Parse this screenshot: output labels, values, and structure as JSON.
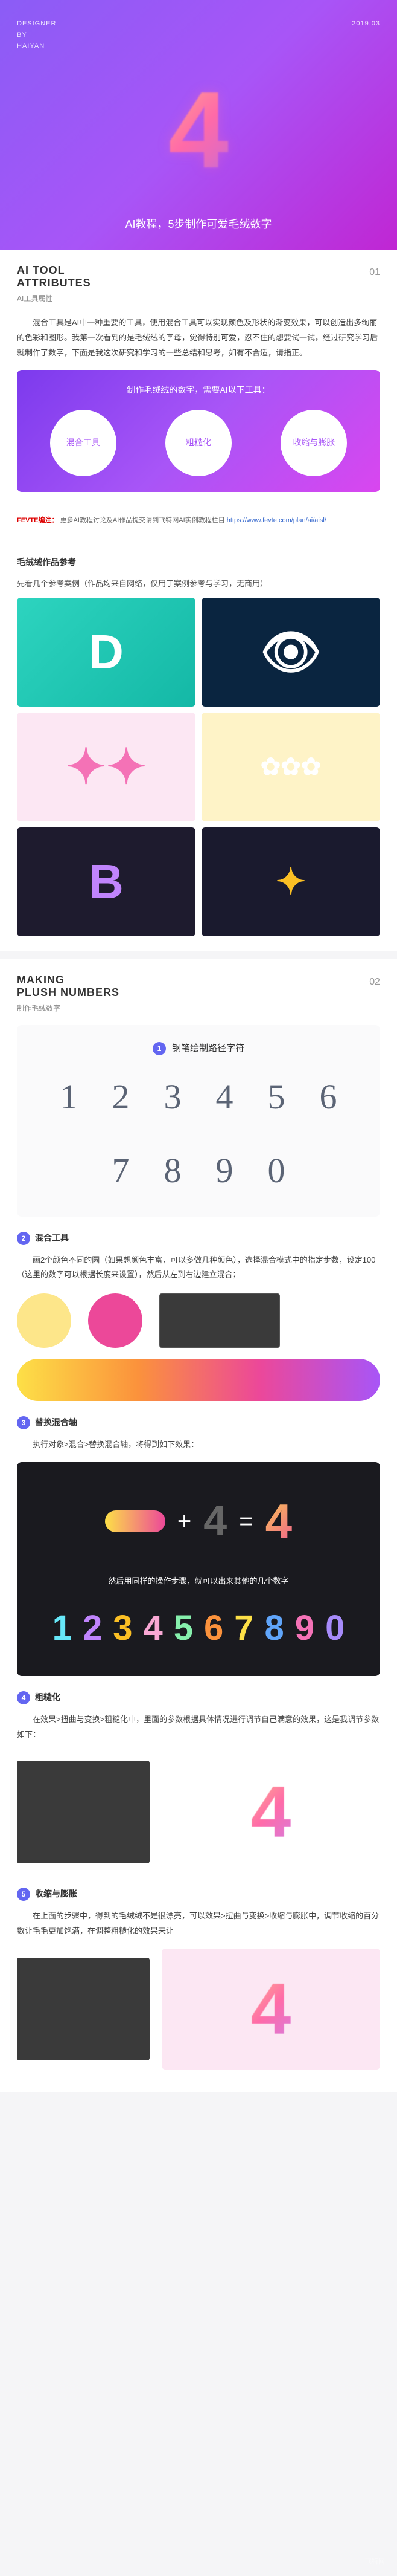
{
  "hero": {
    "designer_label": "DESIGNER\nBY\nHAIYAN",
    "date": "2019.03",
    "title": "AI教程，5步制作可爱毛绒数字"
  },
  "sec1": {
    "en1": "AI TOOL",
    "en2": "ATTRIBUTES",
    "num": "01",
    "cn": "AI工具属性",
    "para": "混合工具是AI中一种重要的工具，使用混合工具可以实现颜色及形状的渐变效果，可以创造出多绚丽的色彩和图形。我第一次看到的是毛绒绒的字母，觉得特别可爱，忍不住的想要试一试，经过研究学习后就制作了数字，下面是我这次研究和学习的一些总结和思考，如有不合适，请指正。",
    "card_title": "制作毛绒绒的数字，需要AI以下工具：",
    "c1": "混合工具",
    "c2": "粗糙化",
    "c3": "收缩与膨胀"
  },
  "notice": {
    "label": "FEVTE编注：",
    "text": "更多AI教程讨论及AI作品提交请到飞特网AI实例教程栏目",
    "url": "https://www.fevte.com/plan/ai/aisl/"
  },
  "ref": {
    "title": "毛绒绒作品参考",
    "desc": "先看几个参考案例（作品均来自网络，仅用于案例参考与学习，无商用）"
  },
  "sec2": {
    "en1": "MAKING",
    "en2": "PLUSH NUMBERS",
    "num": "02",
    "cn": "制作毛绒数字",
    "step1_title": "钢笔绘制路径字符",
    "numbers": [
      "1",
      "2",
      "3",
      "4",
      "5",
      "6",
      "7",
      "8",
      "9",
      "0"
    ],
    "step2_title": "混合工具",
    "step2_para": "画2个颜色不同的圆（如果想颜色丰富，可以多做几种颜色），选择混合模式中的指定步数，设定100（这里的数字可以根据长度来设置），然后从左到右边建立混合；",
    "step3_title": "替换混合轴",
    "step3_para": "执行对象>混合>替换混合轴，将得到如下效果：",
    "step3_note": "然后用同样的操作步骤，就可以出来其他的几个数字",
    "step4_title": "粗糙化",
    "step4_para": "在效果>扭曲与变换>粗糙化中，里面的参数根据具体情况进行调节自己满意的效果，这是我调节参数如下：",
    "step5_title": "收缩与膨胀",
    "step5_para": "在上面的步骤中，得到的毛绒绒不是很漂亮，可以效果>扭曲与变换>收缩与膨胀中，调节收缩的百分数让毛毛更加饱满，在调整粗糙化的效果来让"
  },
  "fuzzy_colors": {
    "n1": "#67e8f9",
    "n2": "#c084fc",
    "n3": "#fbbf24",
    "n4": "#f9a8d4",
    "n5": "#86efac",
    "n6": "#fb923c",
    "n7": "#fde047",
    "n8": "#60a5fa",
    "n9": "#f472b6",
    "n0": "#a78bfa"
  },
  "eq": {
    "plus": "+",
    "equals": "="
  }
}
